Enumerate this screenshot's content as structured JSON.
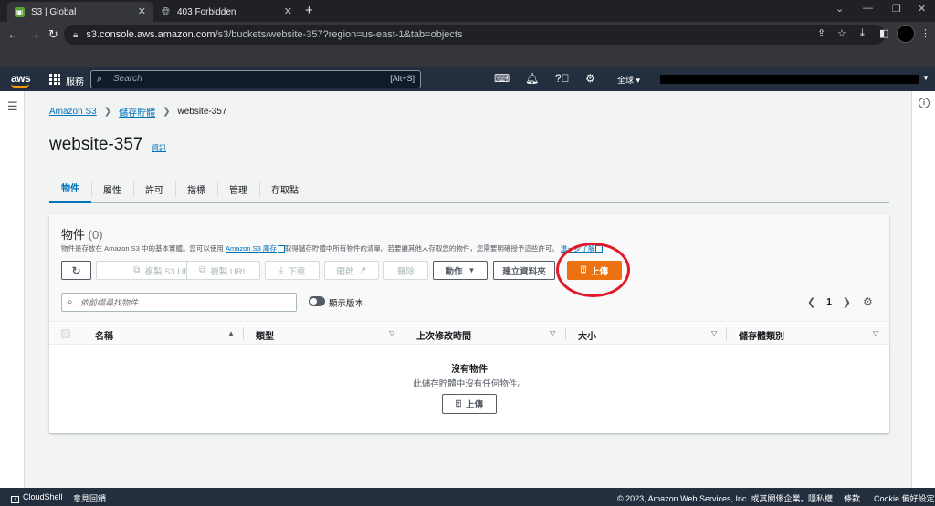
{
  "browser": {
    "tabs": [
      {
        "title": "S3 | Global",
        "icon": "s3-favicon"
      },
      {
        "title": "403 Forbidden",
        "icon": "globe-icon"
      }
    ],
    "url_host": "s3.console.aws.amazon.com",
    "url_path": "/s3/buckets/website-357?region=us-east-1&tab=objects"
  },
  "aws_header": {
    "logo": "aws",
    "services_label": "服務",
    "search_placeholder": "Search",
    "search_shortcut": "[Alt+S]",
    "region_label": "全球 ▾"
  },
  "breadcrumb": {
    "items": [
      "Amazon S3",
      "儲存貯體"
    ],
    "current": "website-357"
  },
  "page": {
    "title": "website-357",
    "info_link": "資訊"
  },
  "tabs": [
    "物件",
    "屬性",
    "許可",
    "指標",
    "管理",
    "存取點"
  ],
  "objects_panel": {
    "title": "物件",
    "count": "(0)",
    "desc_before": "物件是存放在 Amazon S3 中的基本實體。您可以使用",
    "desc_link": "Amazon S3 庫存",
    "desc_after": "取得儲存貯體中所有物件的清單。若要讓其他人存取您的物件，您需要明確授予這些許可。",
    "desc_more": "進一步了解",
    "buttons": {
      "copy_s3_uri": "複製 S3 URI",
      "copy_url": "複製 URL",
      "download": "下載",
      "open": "開啟",
      "delete": "刪除",
      "actions": "動作",
      "create_folder": "建立資料夾",
      "upload": "上傳"
    },
    "filter_placeholder": "依前綴尋找物件",
    "show_versions": "顯示版本",
    "page_number": "1",
    "columns": [
      "名稱",
      "類型",
      "上次修改時間",
      "大小",
      "儲存體類別"
    ],
    "empty_title": "沒有物件",
    "empty_desc": "此儲存貯體中沒有任何物件。",
    "empty_upload": "上傳"
  },
  "footer": {
    "cloudshell": "CloudShell",
    "feedback": "意見回饋",
    "copyright": "© 2023, Amazon Web Services, Inc. 或其關係企業。",
    "privacy": "隱私權",
    "terms": "條款",
    "cookie": "Cookie 偏好設定"
  },
  "colors": {
    "aws_nav": "#232f3e",
    "link": "#0073bb",
    "primary_button": "#ec7211",
    "annotation_circle": "#e3192a"
  }
}
